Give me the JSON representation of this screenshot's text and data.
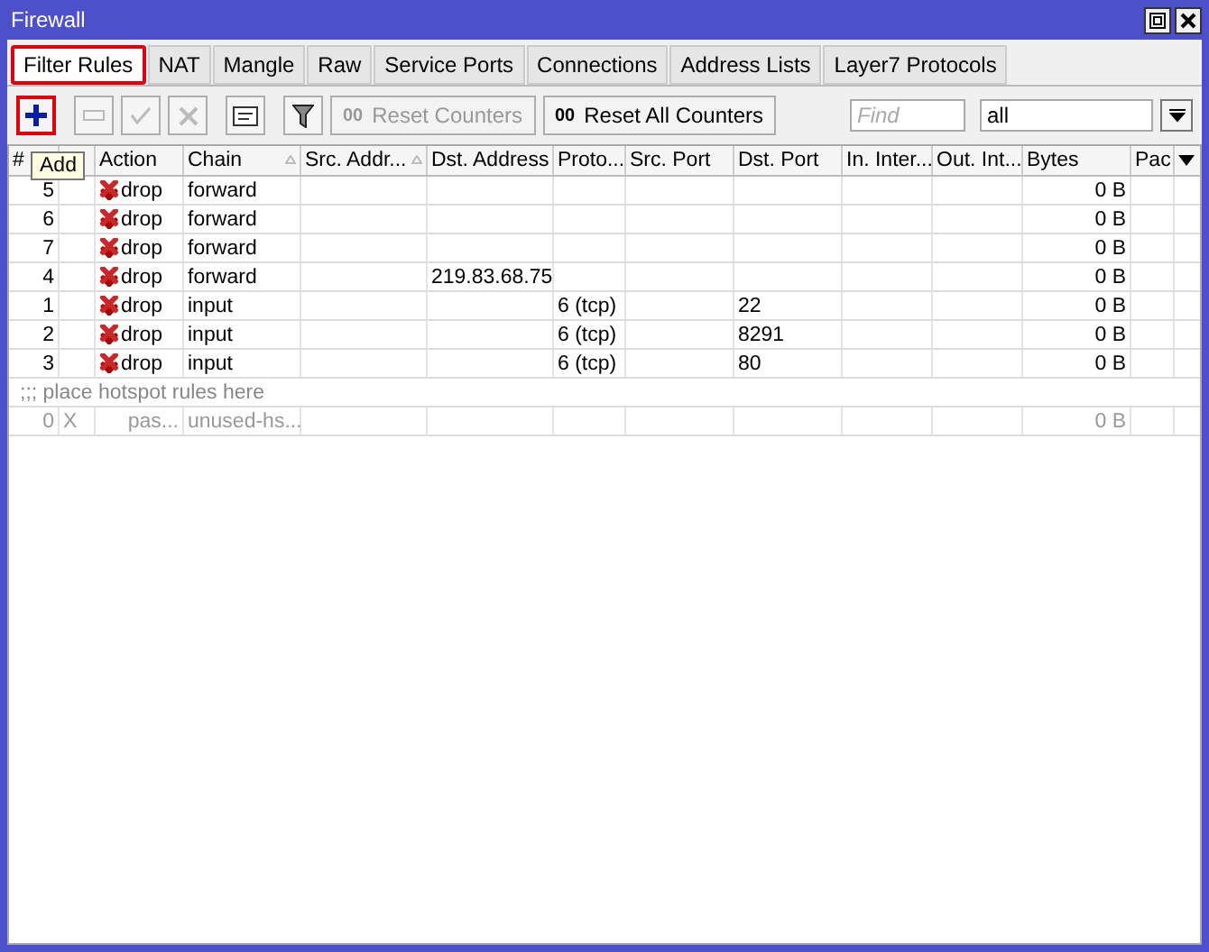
{
  "window": {
    "title": "Firewall"
  },
  "tabs": [
    {
      "label": "Filter Rules",
      "selected": true,
      "highlighted": true
    },
    {
      "label": "NAT",
      "selected": false,
      "highlighted": false
    },
    {
      "label": "Mangle",
      "selected": false,
      "highlighted": false
    },
    {
      "label": "Raw",
      "selected": false,
      "highlighted": false
    },
    {
      "label": "Service Ports",
      "selected": false,
      "highlighted": false
    },
    {
      "label": "Connections",
      "selected": false,
      "highlighted": false
    },
    {
      "label": "Address Lists",
      "selected": false,
      "highlighted": false
    },
    {
      "label": "Layer7 Protocols",
      "selected": false,
      "highlighted": false
    }
  ],
  "toolbar": {
    "tools": [
      {
        "kind": "add",
        "disabled": false,
        "highlighted": true
      },
      {
        "kind": "remove",
        "disabled": true,
        "highlighted": false
      },
      {
        "kind": "enable",
        "disabled": true,
        "highlighted": false
      },
      {
        "kind": "disable",
        "disabled": true,
        "highlighted": false
      },
      {
        "kind": "comment",
        "disabled": false,
        "highlighted": false
      },
      {
        "kind": "filter",
        "disabled": false,
        "highlighted": false
      }
    ],
    "counter_buttons": [
      {
        "icon": "00",
        "label": "Reset Counters",
        "disabled": true
      },
      {
        "icon": "00",
        "label": "Reset All Counters",
        "disabled": false
      }
    ],
    "find": {
      "placeholder": "Find"
    },
    "scope": {
      "value": "all"
    }
  },
  "tooltip": {
    "text": "Add"
  },
  "table": {
    "columns": [
      {
        "label": "#"
      },
      {
        "sorted": false
      },
      {
        "label": "Action",
        "sorted": false
      },
      {
        "label": "Chain",
        "sorted": true
      },
      {
        "label": "Src. Addr...",
        "sorted": true
      },
      {
        "label": "Dst. Address",
        "sorted": false
      },
      {
        "label": "Proto...",
        "sorted": false
      },
      {
        "label": "Src. Port",
        "sorted": false
      },
      {
        "label": "Dst. Port",
        "sorted": false
      },
      {
        "label": "In. Inter...",
        "sorted": false
      },
      {
        "label": "Out. Int...",
        "sorted": false
      },
      {
        "label": "Bytes",
        "sorted": false
      },
      {
        "label": "Pac",
        "sorted": false
      }
    ],
    "rows": [
      {
        "kind": "rule",
        "number": "5",
        "action": "drop",
        "chain": "forward",
        "bytes": "0 B",
        "disabled": false
      },
      {
        "kind": "rule",
        "number": "6",
        "action": "drop",
        "chain": "forward",
        "bytes": "0 B",
        "disabled": false
      },
      {
        "kind": "rule",
        "number": "7",
        "action": "drop",
        "chain": "forward",
        "bytes": "0 B",
        "disabled": false
      },
      {
        "kind": "rule",
        "number": "4",
        "action": "drop",
        "chain": "forward",
        "dst_address": "219.83.68.75",
        "bytes": "0 B",
        "disabled": false
      },
      {
        "kind": "rule",
        "number": "1",
        "action": "drop",
        "chain": "input",
        "protocol": "6 (tcp)",
        "dst_port": "22",
        "bytes": "0 B",
        "disabled": false
      },
      {
        "kind": "rule",
        "number": "2",
        "action": "drop",
        "chain": "input",
        "protocol": "6 (tcp)",
        "dst_port": "8291",
        "bytes": "0 B",
        "disabled": false
      },
      {
        "kind": "rule",
        "number": "3",
        "action": "drop",
        "chain": "input",
        "protocol": "6 (tcp)",
        "dst_port": "80",
        "bytes": "0 B",
        "disabled": false
      },
      {
        "kind": "comment",
        "text": ";;; place hotspot rules here"
      },
      {
        "kind": "rule",
        "number": "0",
        "flag": "X",
        "action": "pas...",
        "chain": "unused-hs...",
        "bytes": "0 B",
        "disabled": true
      }
    ]
  }
}
